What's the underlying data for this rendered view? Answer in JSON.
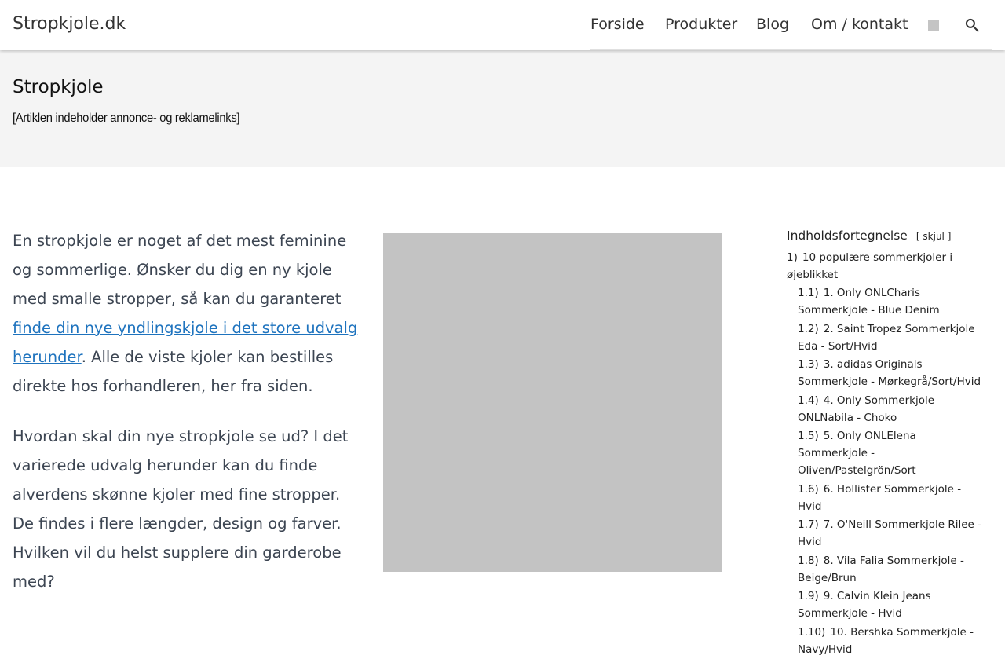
{
  "header": {
    "logo": "Stropkjole.dk",
    "nav": [
      "Forside",
      "Produkter",
      "Blog",
      "Om / kontakt"
    ]
  },
  "hero": {
    "title": "Stropkjole",
    "note": "[Artiklen indeholder annonce- og reklamelinks]"
  },
  "article": {
    "p1_before": "En stropkjole er noget af det mest feminine og sommerlige. Ønsker du dig en ny kjole med smalle stropper, så kan du garanteret ",
    "p1_link": "finde din nye yndlingskjole i det store udvalg herunder",
    "p1_after": ". Alle de viste kjoler kan bestilles direkte hos forhandleren, her fra siden.",
    "p2": "Hvordan skal din nye stropkjole se ud? I det varierede udvalg herunder kan du finde alverdens skønne kjoler med fine stropper. De findes i flere længder, design og farver. Hvilken vil du helst supplere din garderobe med?"
  },
  "toc": {
    "title": "Indholdsfortegnelse",
    "toggle": "[ skjul ]",
    "items": [
      {
        "num": "1)",
        "label": "10 populære sommerkjoler i øjeblikket",
        "children": [
          {
            "num": "1.1)",
            "label": "1. Only ONLCharis Sommerkjole - Blue Denim"
          },
          {
            "num": "1.2)",
            "label": "2. Saint Tropez Sommerkjole Eda - Sort/Hvid"
          },
          {
            "num": "1.3)",
            "label": "3. adidas Originals Sommerkjole - Mørkegrå/Sort/Hvid"
          },
          {
            "num": "1.4)",
            "label": "4. Only Sommerkjole ONLNabila - Choko"
          },
          {
            "num": "1.5)",
            "label": "5. Only ONLElena Sommerkjole - Oliven/Pastelgrön/Sort"
          },
          {
            "num": "1.6)",
            "label": "6. Hollister Sommerkjole - Hvid"
          },
          {
            "num": "1.7)",
            "label": "7. O'Neill Sommerkjole Rilee - Hvid"
          },
          {
            "num": "1.8)",
            "label": "8. Vila Falia Sommerkjole - Beige/Brun"
          },
          {
            "num": "1.9)",
            "label": "9. Calvin Klein Jeans Sommerkjole - Hvid"
          },
          {
            "num": "1.10)",
            "label": "10. Bershka Sommerkjole - Navy/Hvid"
          }
        ]
      }
    ]
  }
}
